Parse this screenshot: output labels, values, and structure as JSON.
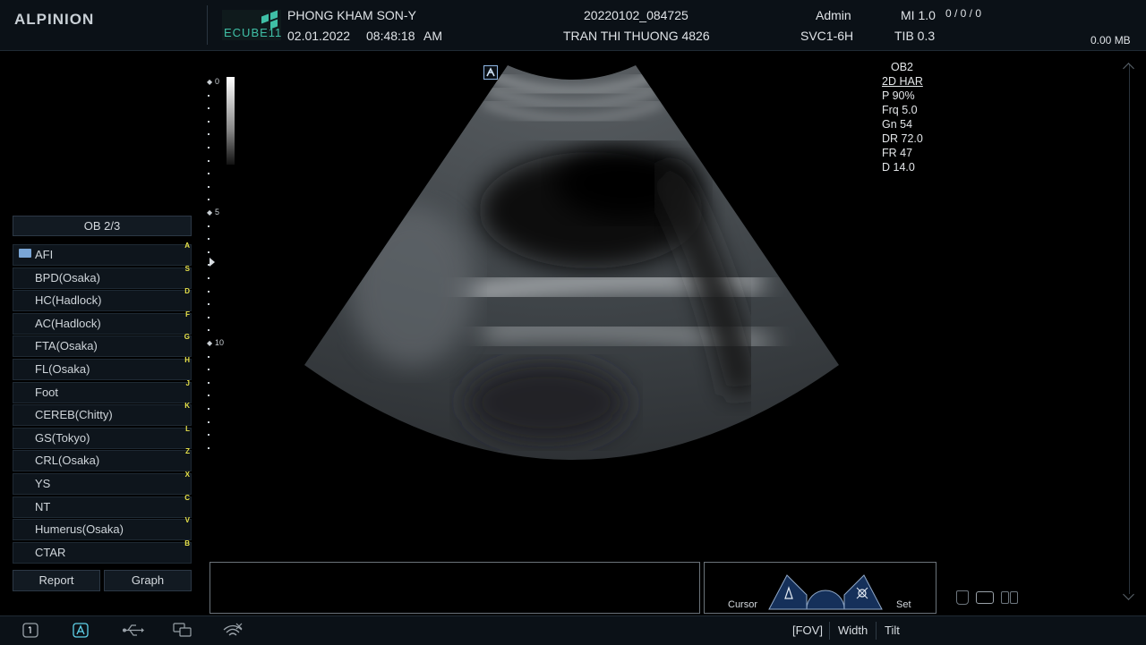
{
  "header": {
    "brand": "ALPINION",
    "device_logo": "ECUBE11",
    "institution": "PHONG KHAM SON-Y",
    "date": "02.01.2022",
    "time": "08:48:18",
    "ampm": "AM",
    "exam_id": "20220102_084725",
    "patient": "TRAN THI THUONG 4826",
    "user": "Admin",
    "probe": "SVC1-6H",
    "mi": "MI 1.0",
    "tib": "TIB 0.3",
    "counter": "0 / 0 / 0",
    "storage": "0.00 MB"
  },
  "depth_scale": {
    "labels": [
      "0",
      "5",
      "10"
    ]
  },
  "params": {
    "preset": "OB2",
    "mode": "2D HAR",
    "power": "P 90%",
    "frequency": "Frq 5.0",
    "gain": "Gn 54",
    "dynamic_range": "DR 72.0",
    "frame_rate": "FR 47",
    "depth": "D 14.0"
  },
  "left_panel": {
    "protocol_title": "OB 2/3",
    "items": [
      {
        "label": "AFI",
        "key": "A"
      },
      {
        "label": "BPD(Osaka)",
        "key": "S"
      },
      {
        "label": "HC(Hadlock)",
        "key": "D"
      },
      {
        "label": "AC(Hadlock)",
        "key": "F"
      },
      {
        "label": "FTA(Osaka)",
        "key": "G"
      },
      {
        "label": "FL(Osaka)",
        "key": "H"
      },
      {
        "label": "Foot",
        "key": "J"
      },
      {
        "label": "CEREB(Chitty)",
        "key": "K"
      },
      {
        "label": "GS(Tokyo)",
        "key": "L"
      },
      {
        "label": "CRL(Osaka)",
        "key": "Z"
      },
      {
        "label": "YS",
        "key": "X"
      },
      {
        "label": "NT",
        "key": "C"
      },
      {
        "label": "Humerus(Osaka)",
        "key": "V"
      },
      {
        "label": "CTAR",
        "key": "B"
      }
    ],
    "report_label": "Report",
    "graph_label": "Graph"
  },
  "trackball": {
    "cursor_label": "Cursor",
    "set_label": "Set"
  },
  "footer": {
    "fov_label": "[FOV]",
    "width_label": "Width",
    "tilt_label": "Tilt",
    "icons": [
      "screen-1-icon",
      "annotation-icon",
      "usb-icon",
      "network-icon",
      "wifi-icon"
    ]
  },
  "colors": {
    "accent": "#3fc0a6",
    "hotkey": "#e8e34a",
    "panel": "#0e151c"
  }
}
